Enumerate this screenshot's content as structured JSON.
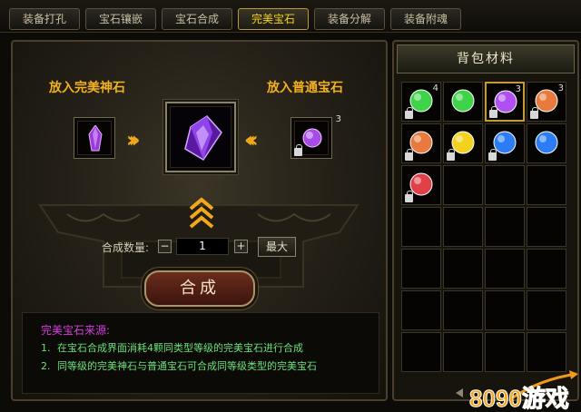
{
  "tabs": [
    {
      "label": "装备打孔",
      "active": false
    },
    {
      "label": "宝石镶嵌",
      "active": false
    },
    {
      "label": "宝石合成",
      "active": false
    },
    {
      "label": "完美宝石",
      "active": true
    },
    {
      "label": "装备分解",
      "active": false
    },
    {
      "label": "装备附魂",
      "active": false
    }
  ],
  "combine": {
    "label_perfect_stone": "放入完美神石",
    "label_normal_gem": "放入普通宝石",
    "normal_gem_count": "3",
    "qty_label": "合成数量:",
    "qty_minus": "−",
    "qty_value": "1",
    "qty_plus": "+",
    "max_button": "最大",
    "combine_button": "合成"
  },
  "source": {
    "title": "完美宝石来源:",
    "lines": [
      {
        "num": "1.",
        "text": "在宝石合成界面消耗4颗同类型等级的完美宝石进行合成"
      },
      {
        "num": "2.",
        "text": "同等级的完美神石与普通宝石可合成同等级类型的完美宝石"
      }
    ]
  },
  "bag": {
    "title": "背包材料",
    "items": [
      {
        "gem": "green-gem-icon",
        "color": "#3fd34a",
        "count": "4",
        "locked": true
      },
      {
        "gem": "green-gem-icon",
        "color": "#3fd34a",
        "count": "",
        "locked": false
      },
      {
        "gem": "purple-gem-icon",
        "color": "#b050f0",
        "count": "3",
        "locked": true,
        "selected": true
      },
      {
        "gem": "orange-gem-icon",
        "color": "#e77a3c",
        "count": "3",
        "locked": true
      },
      {
        "gem": "orange-gem-icon",
        "color": "#e77a3c",
        "count": "",
        "locked": true
      },
      {
        "gem": "yellow-gem-icon",
        "color": "#f2d21f",
        "count": "",
        "locked": true
      },
      {
        "gem": "blue-gem-icon",
        "color": "#2b7cf5",
        "count": "",
        "locked": true
      },
      {
        "gem": "blue-gem-icon",
        "color": "#2b7cf5",
        "count": "",
        "locked": false
      },
      {
        "gem": "red-gem-icon",
        "color": "#e04048",
        "count": "",
        "locked": true
      }
    ],
    "total_cells": 28
  },
  "watermark": {
    "text": "8090游戏"
  },
  "colors": {
    "accent_gold": "#f2b11e",
    "tab_active": "#f4d21f",
    "source_title": "#d53ee0",
    "source_text": "#6be07a"
  }
}
